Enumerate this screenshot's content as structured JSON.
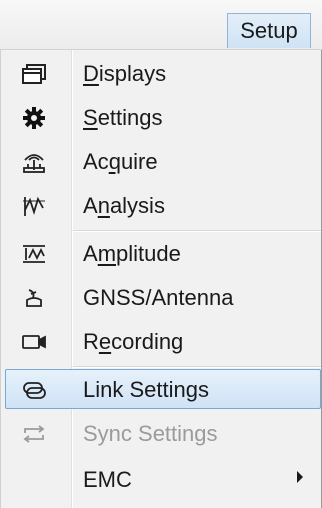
{
  "menubar": {
    "setup_label": "Setup"
  },
  "menu": {
    "items": [
      {
        "pre": "",
        "ul": "D",
        "post": "isplays",
        "icon": "window-icon"
      },
      {
        "pre": "",
        "ul": "S",
        "post": "ettings",
        "icon": "gear-icon"
      },
      {
        "pre": "Ac",
        "ul": "q",
        "post": "uire",
        "icon": "acquire-icon"
      },
      {
        "pre": "A",
        "ul": "n",
        "post": "alysis",
        "icon": "analysis-icon"
      },
      {
        "pre": "A",
        "ul": "m",
        "post": "plitude",
        "icon": "amplitude-icon"
      },
      {
        "pre": "GNSS/Antenna",
        "ul": "",
        "post": "",
        "icon": "antenna-icon"
      },
      {
        "pre": "R",
        "ul": "e",
        "post": "cording",
        "icon": "camera-icon"
      },
      {
        "pre": "Link Settings",
        "ul": "",
        "post": "",
        "icon": "link-icon",
        "highlighted": true
      },
      {
        "pre": "Sync Settings",
        "ul": "",
        "post": "",
        "icon": "sync-icon",
        "disabled": true
      },
      {
        "pre": "EMC",
        "ul": "",
        "post": "",
        "icon": "",
        "submenu": true
      }
    ]
  }
}
